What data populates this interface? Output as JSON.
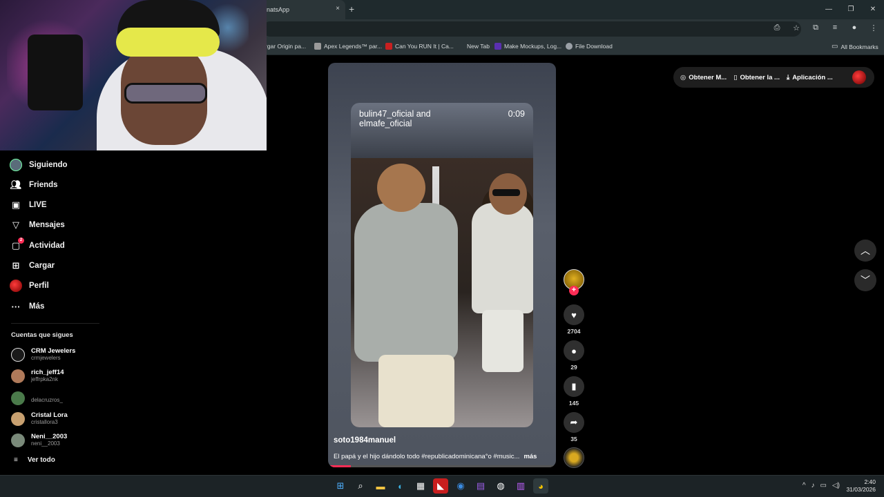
{
  "browser": {
    "tab_title": "natsApp",
    "tab_close": "×",
    "new_tab": "+",
    "window_controls": {
      "minimize": "—",
      "restore": "❐",
      "close": "✕"
    },
    "address_icons": [
      "install-icon",
      "star-icon",
      "extensions-icon",
      "media-icon",
      "profile-icon",
      "menu-icon"
    ],
    "bookmarks": [
      {
        "label": "rgar Origin pa...",
        "icon": "origin-icon",
        "color": "#f56c2d"
      },
      {
        "label": "Apex Legends™ par...",
        "icon": "apex-icon",
        "color": "#9a9a9a"
      },
      {
        "label": "Can You RUN It | Ca...",
        "icon": "cyri-icon",
        "color": "#c82020"
      },
      {
        "label": "New Tab",
        "icon": "newtab-icon",
        "color": "#3a3a3a"
      },
      {
        "label": "Make Mockups, Log...",
        "icon": "placeit-icon",
        "color": "#5a2fb0"
      },
      {
        "label": "File Download",
        "icon": "globe-icon",
        "color": "#9aa0a6"
      }
    ],
    "all_bookmarks": "All Bookmarks"
  },
  "sidebar": {
    "items": [
      {
        "label": "Siguiendo",
        "icon": "following-avatar-icon"
      },
      {
        "label": "Friends",
        "icon": "friends-icon"
      },
      {
        "label": "LIVE",
        "icon": "live-icon"
      },
      {
        "label": "Mensajes",
        "icon": "messages-icon"
      },
      {
        "label": "Actividad",
        "icon": "activity-icon",
        "badge": "2"
      },
      {
        "label": "Cargar",
        "icon": "upload-icon"
      },
      {
        "label": "Perfil",
        "icon": "profile-avatar-icon"
      },
      {
        "label": "Más",
        "icon": "more-icon"
      }
    ],
    "following_title": "Cuentas que sigues",
    "accounts": [
      {
        "name": "CRM Jewelers",
        "handle": "crmjewelers",
        "color": "#1a1a1a"
      },
      {
        "name": "rich_jeff14",
        "handle": "jeffrpka2nk",
        "color": "#b07a5a"
      },
      {
        "name": "",
        "handle": "delacruzros_",
        "color": "#4a7a4a"
      },
      {
        "name": "Cristal Lora",
        "handle": "cristallora3",
        "color": "#c8a070"
      },
      {
        "name": "Neni__2003",
        "handle": "neni__2003",
        "color": "#7a8a7a"
      }
    ],
    "see_all": "Ver todo"
  },
  "video": {
    "overlay_caption": "bulin47_oficial and elmafe_oficial",
    "duration": "0:09",
    "author": "soto1984manuel",
    "description": "El papá y el hijo dándolo todo #republicadominicana°o #music...",
    "more": "más",
    "progress": 0.1
  },
  "actions": {
    "likes": "2704",
    "comments": "29",
    "saves": "145",
    "shares": "35"
  },
  "top_pill": {
    "items": [
      "Obtener M...",
      "Obtener la ...",
      "Aplicación ..."
    ]
  },
  "taskbar": {
    "icons": [
      "windows-start-icon",
      "search-icon",
      "file-explorer-icon",
      "edge-icon",
      "store-icon",
      "amd-icon",
      "game-icon",
      "twitch-icon",
      "steam-icon",
      "winrar-icon",
      "chrome-icon"
    ],
    "time": "2:40",
    "date": "31/03/2026"
  }
}
